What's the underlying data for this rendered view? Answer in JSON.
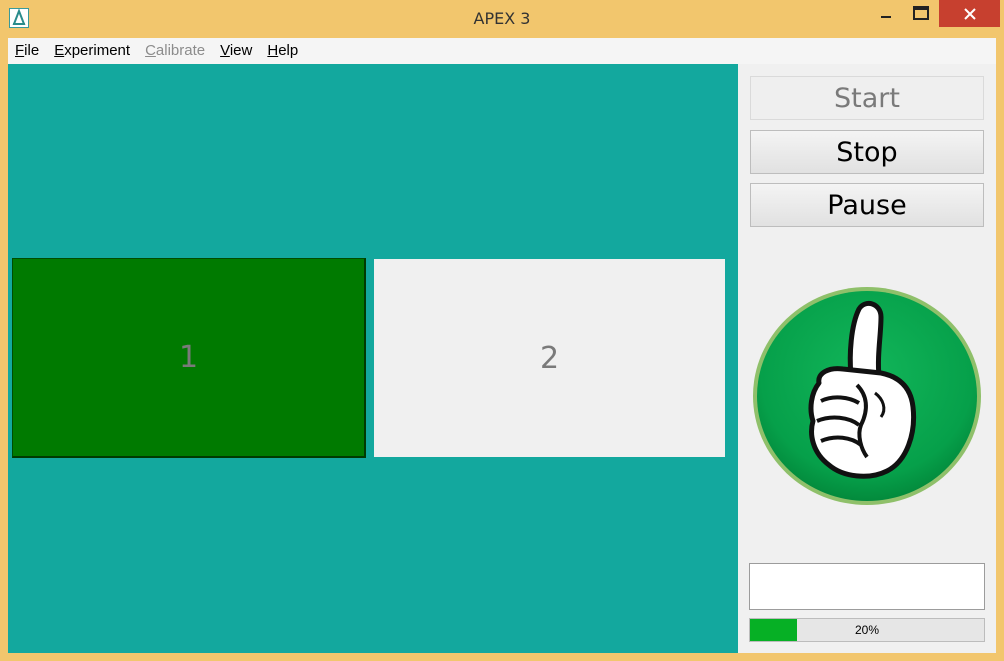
{
  "window": {
    "title": "APEX 3",
    "frame_color": "#f2c66d",
    "close_color": "#c7402f"
  },
  "icons": {
    "app": "apex-app-icon",
    "minimize": "minimize-icon",
    "maximize": "maximize-icon",
    "close": "close-icon",
    "feedback": "thumbs-up-icon"
  },
  "menu": {
    "file": {
      "mnemonic": "F",
      "rest": "ile"
    },
    "experiment": {
      "mnemonic": "E",
      "rest": "xperiment"
    },
    "calibrate": {
      "mnemonic": "C",
      "rest": "alibrate",
      "enabled": false
    },
    "view": {
      "mnemonic": "V",
      "rest": "iew"
    },
    "help": {
      "mnemonic": "H",
      "rest": "elp"
    }
  },
  "stage": {
    "background": "#13a89e",
    "answers": [
      {
        "label": "1",
        "color": "#007a00",
        "state": "highlighted"
      },
      {
        "label": "2",
        "color": "#f0f0f0",
        "state": "normal"
      }
    ]
  },
  "controls": {
    "start": {
      "label": "Start",
      "enabled": false
    },
    "stop": {
      "label": "Stop",
      "enabled": true
    },
    "pause": {
      "label": "Pause",
      "enabled": true
    }
  },
  "status": {
    "message": "",
    "progress_percent": 20,
    "progress_text": "20%",
    "progress_color": "#06b025"
  }
}
